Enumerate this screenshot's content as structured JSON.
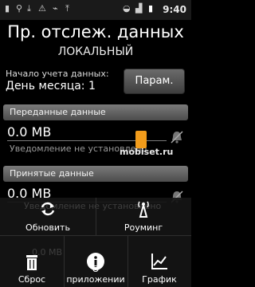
{
  "status_bar": {
    "time": "9:40"
  },
  "header": {
    "title": "Пр. отслеж. данных",
    "subtitle": "ЛОКАЛЬНЫЙ"
  },
  "start": {
    "label": "Начало учета данных:",
    "value": "День месяца: 1",
    "params_button": "Парам."
  },
  "sent": {
    "header": "Переданные данные",
    "value": "0.0 MB",
    "note": "Уведомление не установлено"
  },
  "received": {
    "header": "Принятые данные",
    "value": "0.0 MB"
  },
  "menu": {
    "refresh": "Обновить",
    "roaming": "Роуминг",
    "reset": "Сброс",
    "about": "О приложении",
    "graph": "График"
  },
  "watermark": "mobiset.ru",
  "colors": {
    "background": "#000000",
    "section_header": "#6a6a6a",
    "logo": "#f29c1b"
  }
}
